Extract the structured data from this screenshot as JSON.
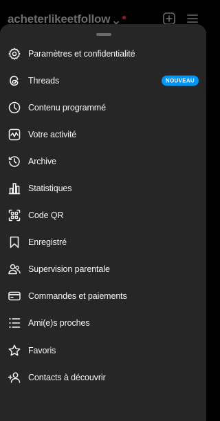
{
  "header": {
    "username": "acheterlikeetfollow"
  },
  "menu": {
    "items": [
      {
        "label": "Paramètres et confidentialité",
        "icon": "settings-icon"
      },
      {
        "label": "Threads",
        "icon": "threads-icon",
        "badge": "NOUVEAU"
      },
      {
        "label": "Contenu programmé",
        "icon": "clock-icon"
      },
      {
        "label": "Votre activité",
        "icon": "activity-icon"
      },
      {
        "label": "Archive",
        "icon": "archive-icon"
      },
      {
        "label": "Statistiques",
        "icon": "bar-chart-icon"
      },
      {
        "label": "Code QR",
        "icon": "qr-code-icon"
      },
      {
        "label": "Enregistré",
        "icon": "bookmark-icon"
      },
      {
        "label": "Supervision parentale",
        "icon": "supervision-icon"
      },
      {
        "label": "Commandes et paiements",
        "icon": "card-icon"
      },
      {
        "label": "Ami(e)s proches",
        "icon": "close-friends-icon"
      },
      {
        "label": "Favoris",
        "icon": "star-icon"
      },
      {
        "label": "Contacts à découvrir",
        "icon": "add-person-icon"
      }
    ]
  },
  "colors": {
    "sheet": "#262626",
    "badge": "#0095f6",
    "text": "#f5f5f5"
  }
}
